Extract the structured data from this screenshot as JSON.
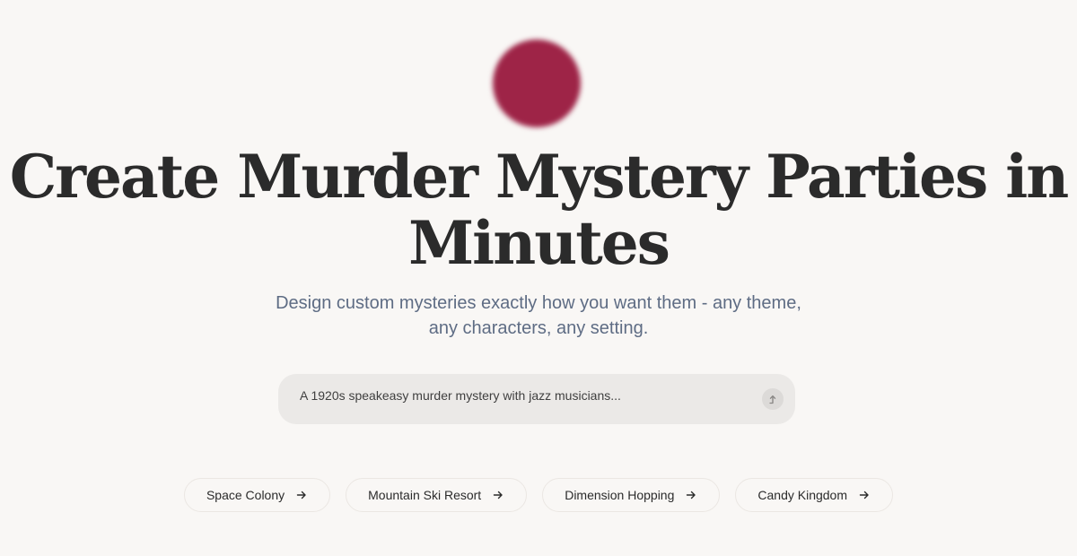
{
  "hero": {
    "headline_line1": "Create Murder Mystery Parties in",
    "headline_line2": "Minutes",
    "subtitle_line1": "Design custom mysteries exactly how you want them - any theme,",
    "subtitle_line2": "any characters, any setting.",
    "orb_color": "#9e2447"
  },
  "prompt": {
    "placeholder": "A 1920s speakeasy murder mystery with jazz musicians...",
    "value": "",
    "submit_icon": "arrow-up-icon"
  },
  "suggestions": [
    {
      "label": "Space Colony",
      "icon": "arrow-right-icon"
    },
    {
      "label": "Mountain Ski Resort",
      "icon": "arrow-right-icon"
    },
    {
      "label": "Dimension Hopping",
      "icon": "arrow-right-icon"
    },
    {
      "label": "Candy Kingdom",
      "icon": "arrow-right-icon"
    }
  ]
}
